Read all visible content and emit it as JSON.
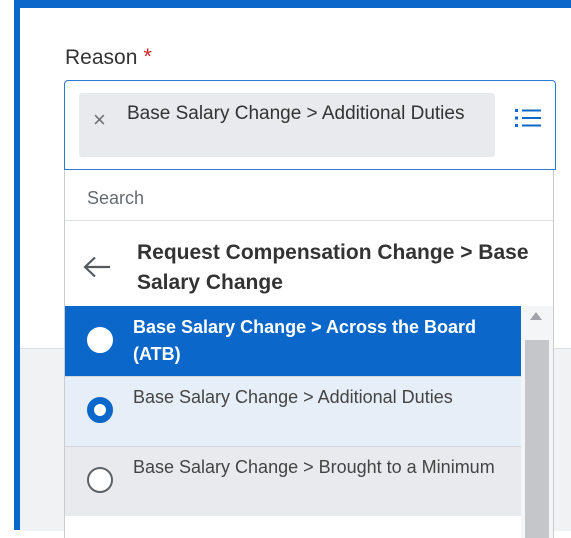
{
  "field": {
    "label": "Reason",
    "required_marker": "*",
    "selected_value": "Base Salary Change > Additional Duties",
    "remove_glyph": "×"
  },
  "dropdown": {
    "search_placeholder": "Search",
    "breadcrumb": "Request Compensation Change > Base Salary Change",
    "options": [
      {
        "label": "Base Salary Change > Across the Board (ATB)",
        "state": "highlighted"
      },
      {
        "label": "Base Salary Change > Additional Duties",
        "state": "selected"
      },
      {
        "label": "Base Salary Change > Brought to a Minimum",
        "state": "unselected"
      }
    ]
  },
  "icons": {
    "remove": "close-icon",
    "list": "list-icon",
    "back": "arrow-left-icon"
  },
  "colors": {
    "accent": "#0b67c9",
    "required": "#d6262b",
    "chip_bg": "#e8eaed",
    "selected_row_bg": "#e6eef8"
  }
}
